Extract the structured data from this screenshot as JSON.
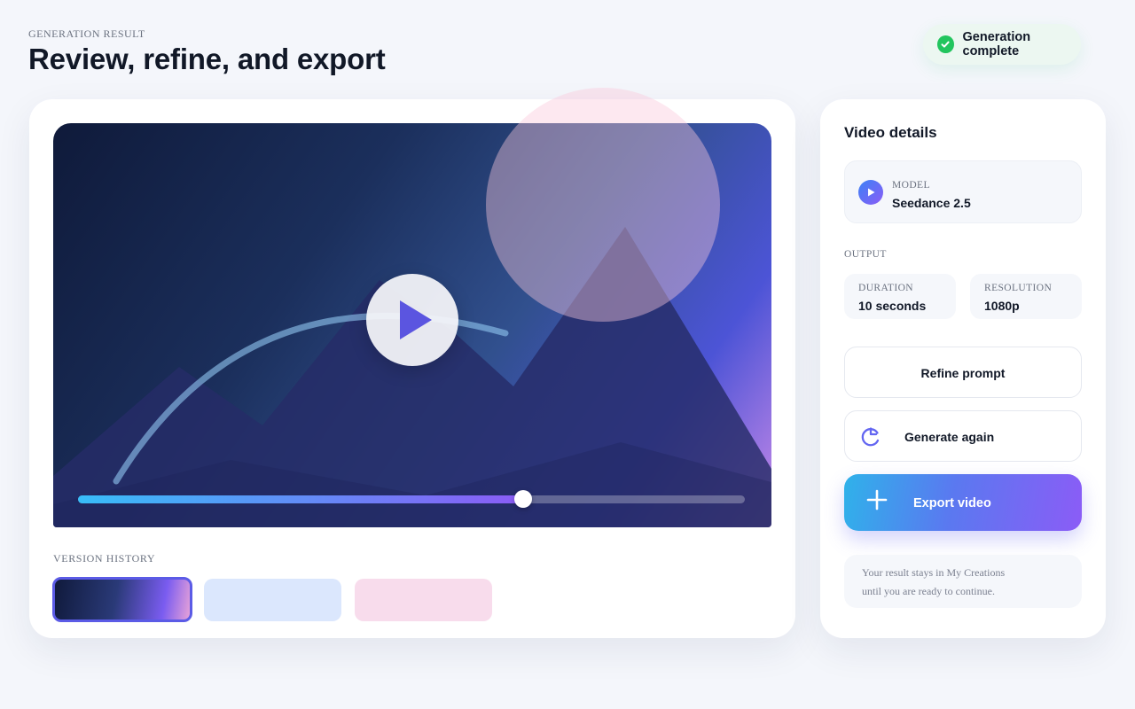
{
  "header": {
    "eyebrow": "GENERATION RESULT",
    "title": "Review, refine, and export",
    "status": "Generation complete"
  },
  "player": {
    "progress_fraction": 0.668
  },
  "version_history": {
    "label": "VERSION HISTORY",
    "versions": [
      {
        "selected": true
      },
      {
        "selected": false
      },
      {
        "selected": false
      }
    ]
  },
  "details": {
    "title": "Video details",
    "model_caption": "MODEL",
    "model_value": "Seedance 2.5",
    "output_label": "OUTPUT",
    "duration_caption": "DURATION",
    "duration_value": "10 seconds",
    "resolution_caption": "RESOLUTION",
    "resolution_value": "1080p"
  },
  "actions": {
    "refine": "Refine prompt",
    "regenerate": "Generate again",
    "export": "Export video"
  },
  "note": {
    "line1": "Your result stays in My Creations",
    "line2": "until you are ready to continue."
  },
  "icons": {
    "status": "check-circle-icon",
    "play": "play-icon",
    "model": "play-circle-icon",
    "regenerate": "refresh-icon",
    "export": "plus-icon"
  },
  "colors": {
    "accent": "#6366f1",
    "success": "#22c55e",
    "export_gradient_start": "#2fb2ea",
    "export_gradient_end": "#8b5cf6"
  }
}
